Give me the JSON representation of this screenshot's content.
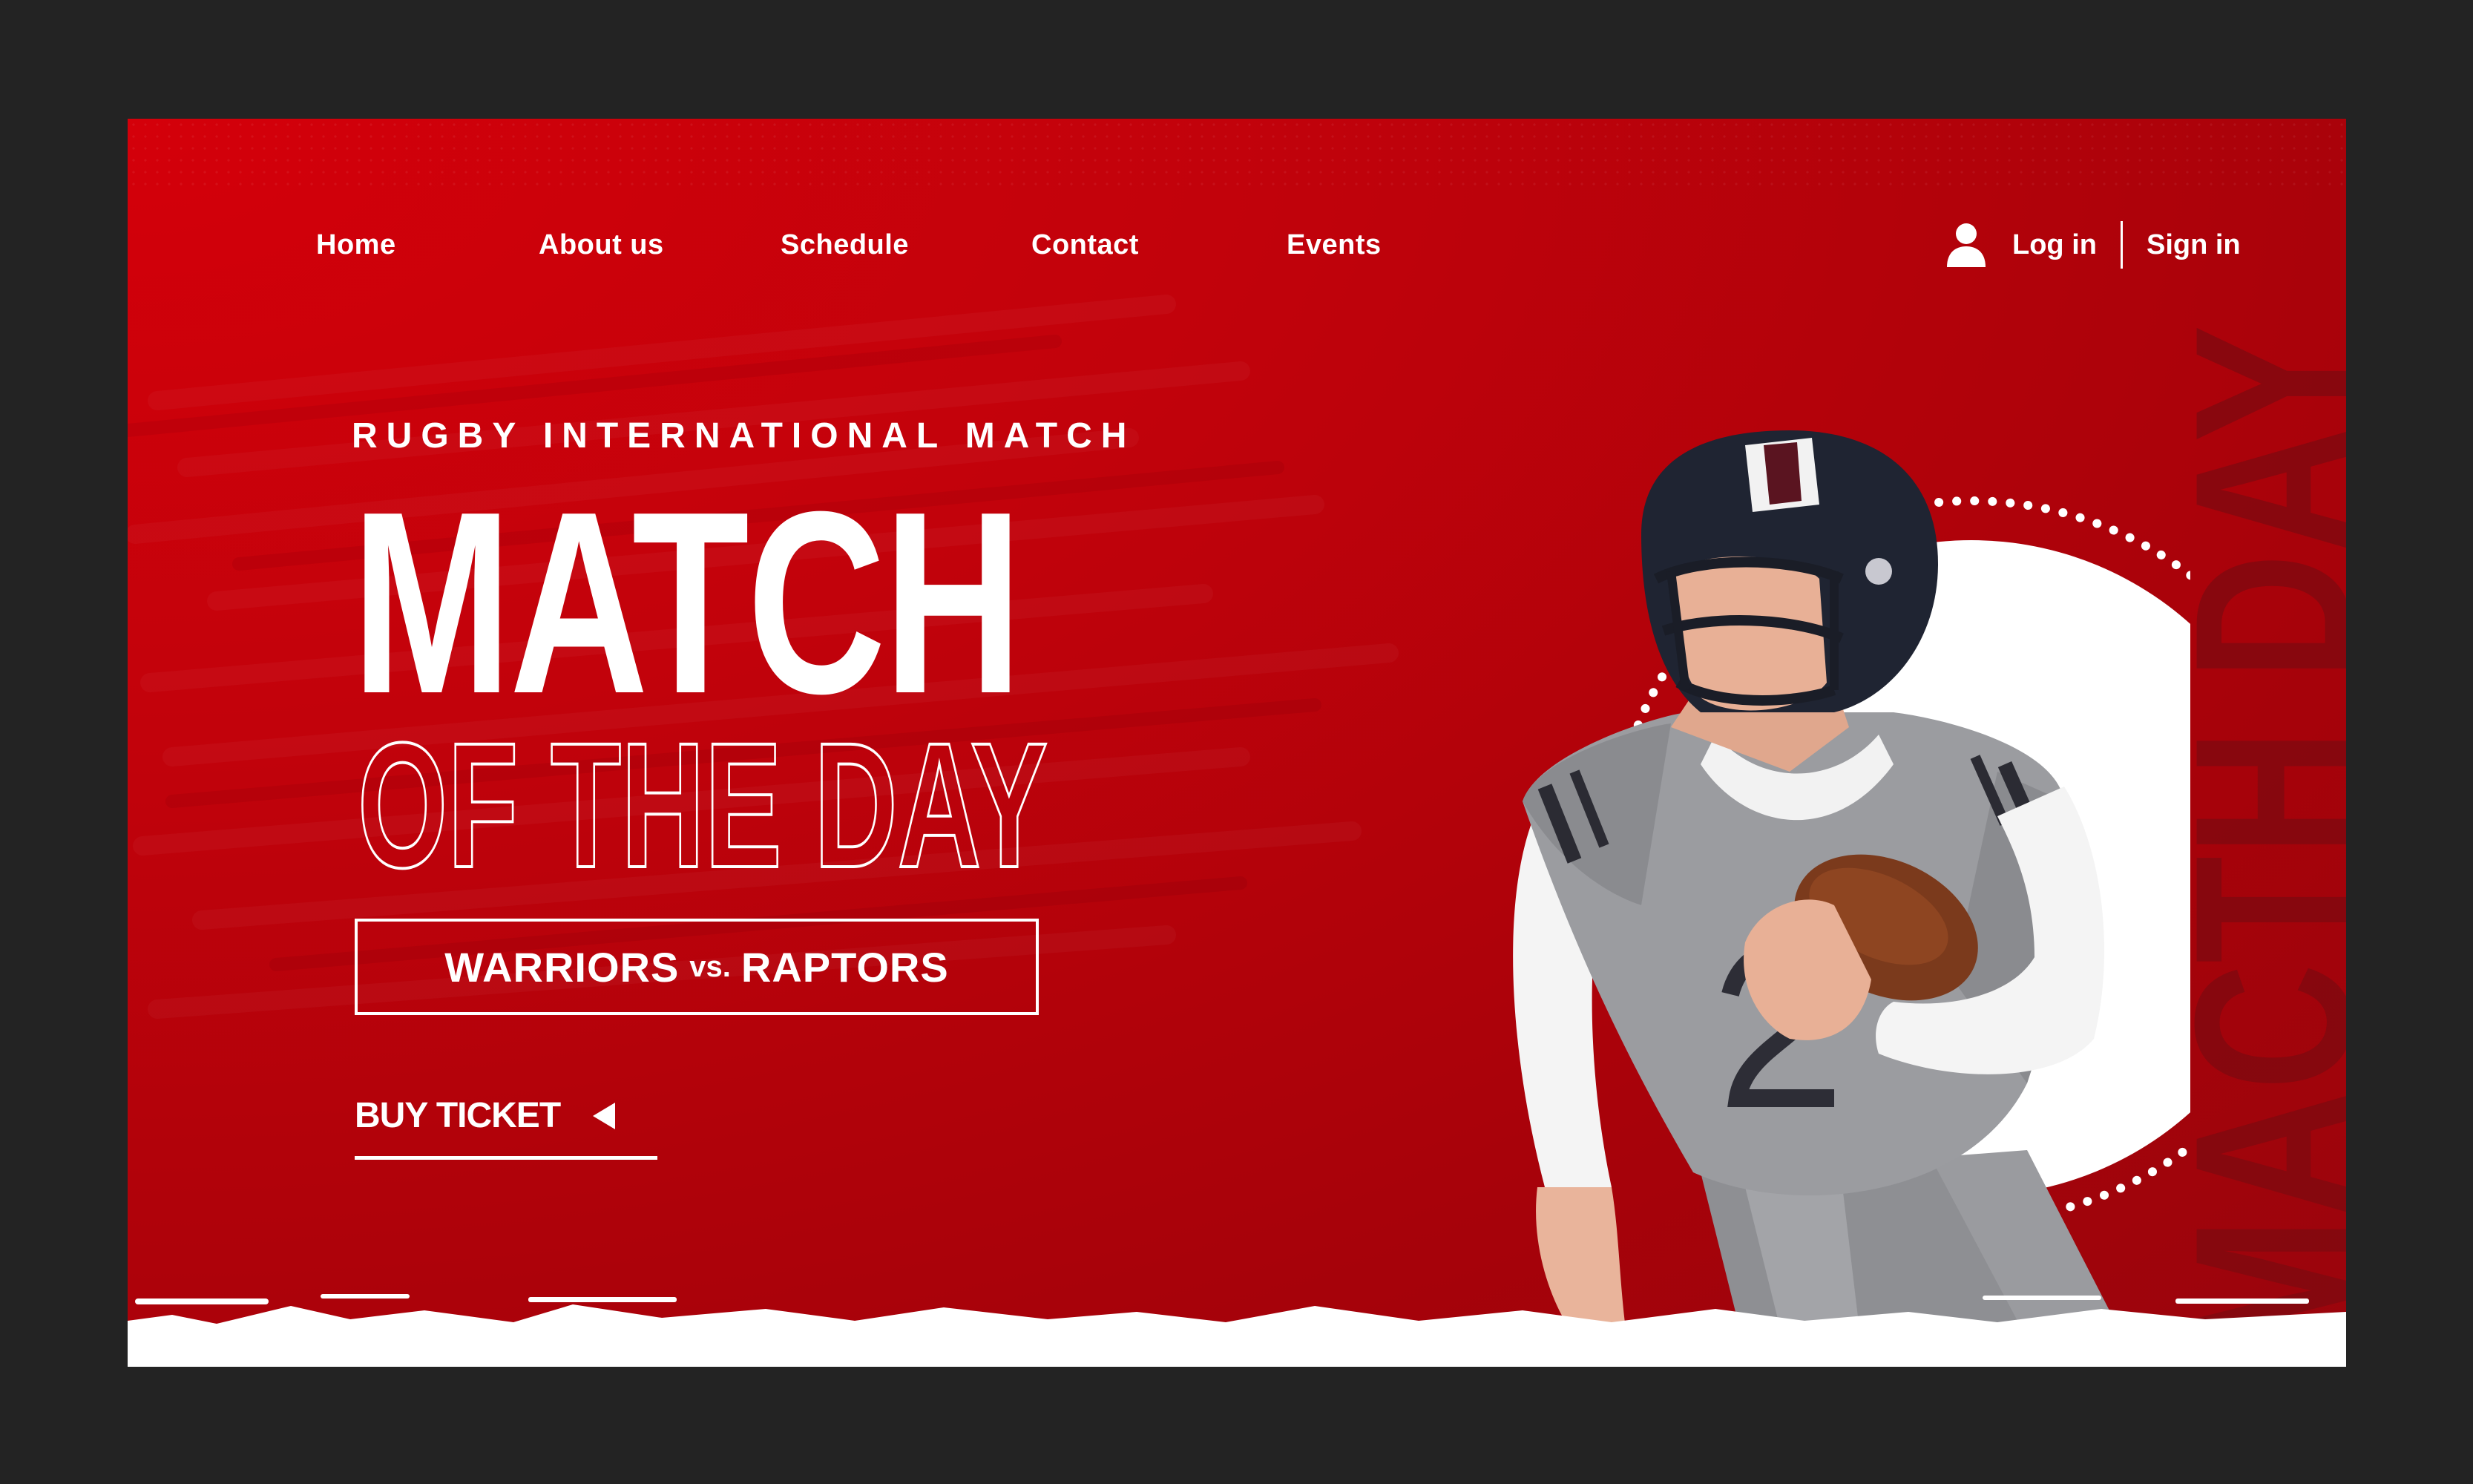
{
  "nav": {
    "items": [
      {
        "label": "Home"
      },
      {
        "label": "About us"
      },
      {
        "label": "Schedule"
      },
      {
        "label": "Contact"
      },
      {
        "label": "Events"
      }
    ],
    "login": "Log in",
    "signin": "Sign in"
  },
  "hero": {
    "kicker": "RUGBY INTERNATIONAL MATCH",
    "title_main": "MATCH",
    "title_outline": "OF THE DAY",
    "team_a": "WARRIORS",
    "vs": "vs.",
    "team_b": "RAPTORS",
    "cta": "BUY TICKET",
    "vertical_text": "MACTH DAY"
  },
  "colors": {
    "background": "#232323",
    "brand_red": "#c2020b",
    "text": "#ffffff"
  },
  "icons": {
    "user": "user-icon",
    "cta_arrow": "triangle-left-icon"
  }
}
